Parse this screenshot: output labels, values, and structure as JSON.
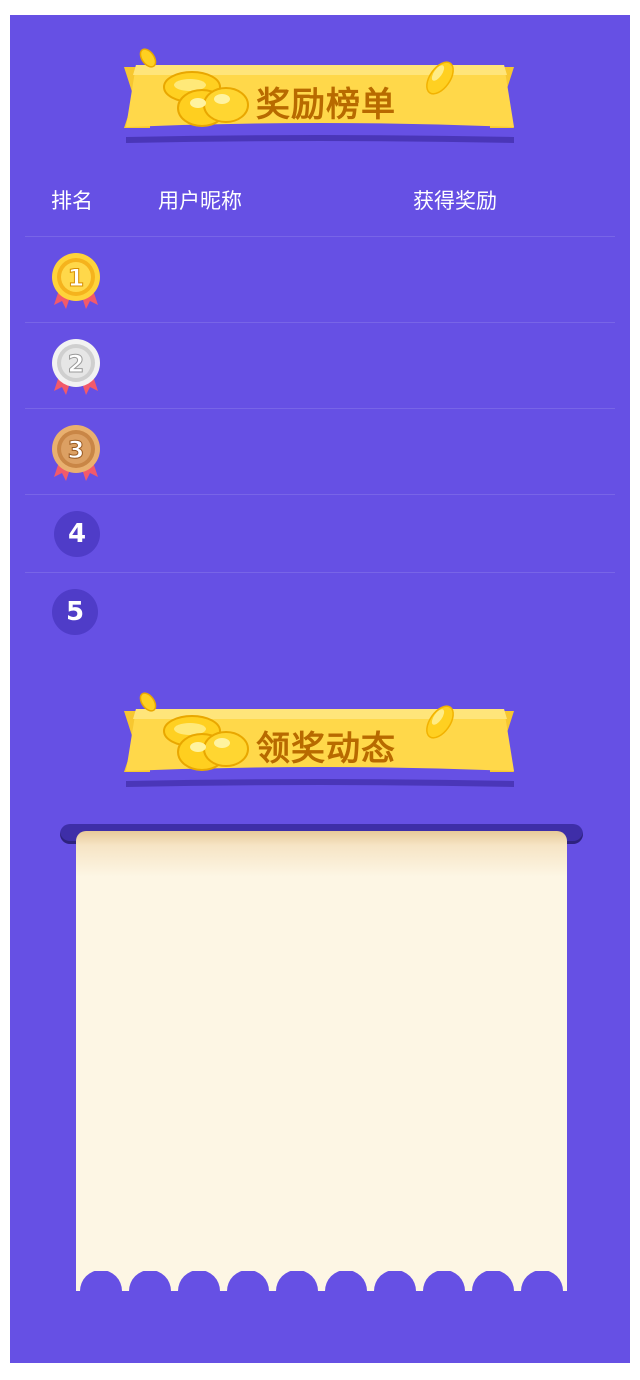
{
  "leaderboard": {
    "title": "奖励榜单",
    "columns": {
      "rank": "排名",
      "nickname": "用户昵称",
      "reward": "获得奖励"
    },
    "rows": [
      {
        "rank": "1",
        "tier": "gold"
      },
      {
        "rank": "2",
        "tier": "silver"
      },
      {
        "rank": "3",
        "tier": "bronze"
      },
      {
        "rank": "4",
        "tier": "plain"
      },
      {
        "rank": "5",
        "tier": "plain"
      }
    ]
  },
  "claims": {
    "title": "领奖动态"
  },
  "colors": {
    "background": "#6650e4",
    "ribbon": "#ffd84a",
    "title_text": "#b86a00",
    "scroll_paper": "#fdf6e4",
    "scroll_rod": "#3e2ea8",
    "rank_circle": "#4f3cc8"
  }
}
